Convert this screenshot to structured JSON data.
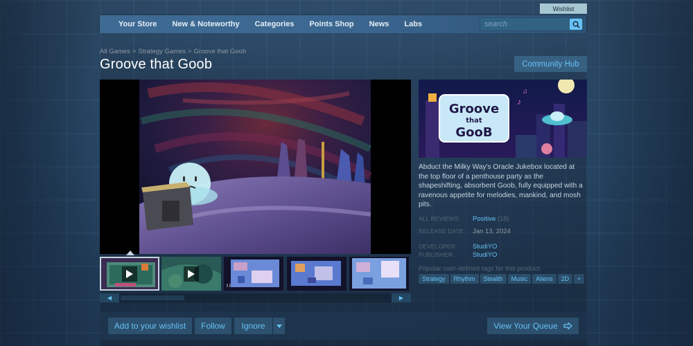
{
  "header": {
    "wishlist_label": "Wishlist"
  },
  "nav": {
    "items": [
      {
        "label": "Your Store"
      },
      {
        "label": "New & Noteworthy"
      },
      {
        "label": "Categories"
      },
      {
        "label": "Points Shop"
      },
      {
        "label": "News"
      },
      {
        "label": "Labs"
      }
    ],
    "search_placeholder": "search"
  },
  "breadcrumb": {
    "items": [
      "All Games",
      "Strategy Games",
      "Groove that Goob"
    ],
    "separator": ">"
  },
  "game": {
    "title": "Groove that Goob",
    "community_hub_label": "Community Hub",
    "capsule_art_text": "Groove that GooB",
    "description": "Abduct the Milky Way's Oracle Jukebox located at the top floor of a penthouse party as the shapeshifting, absorbent Goob, fully equipped with a ravenous appetite for melodies, mankind, and mosh pits.",
    "reviews_label": "ALL REVIEWS:",
    "reviews_value": "Positive",
    "reviews_count": "(18)",
    "release_label": "RELEASE DATE:",
    "release_value": "Jan 13, 2024",
    "developer_label": "DEVELOPER:",
    "developer_value": "StudiYO",
    "publisher_label": "PUBLISHER:",
    "publisher_value": "StudiYO",
    "tags_label": "Popular user-defined tags for this product:",
    "tags": [
      "Strategy",
      "Rhythm",
      "Stealth",
      "Music",
      "Aliens",
      "2D",
      "+"
    ]
  },
  "media": {
    "thumbnail_count": 5,
    "active_thumbnail": 1,
    "thumbnail_3_label": "I I"
  },
  "actions": {
    "wishlist_label": "Add to your wishlist",
    "follow_label": "Follow",
    "ignore_label": "Ignore",
    "queue_label": "View Your Queue"
  },
  "colors": {
    "accent": "#67c1f5",
    "background": "#1b2838",
    "nav": "#3e6b94"
  }
}
